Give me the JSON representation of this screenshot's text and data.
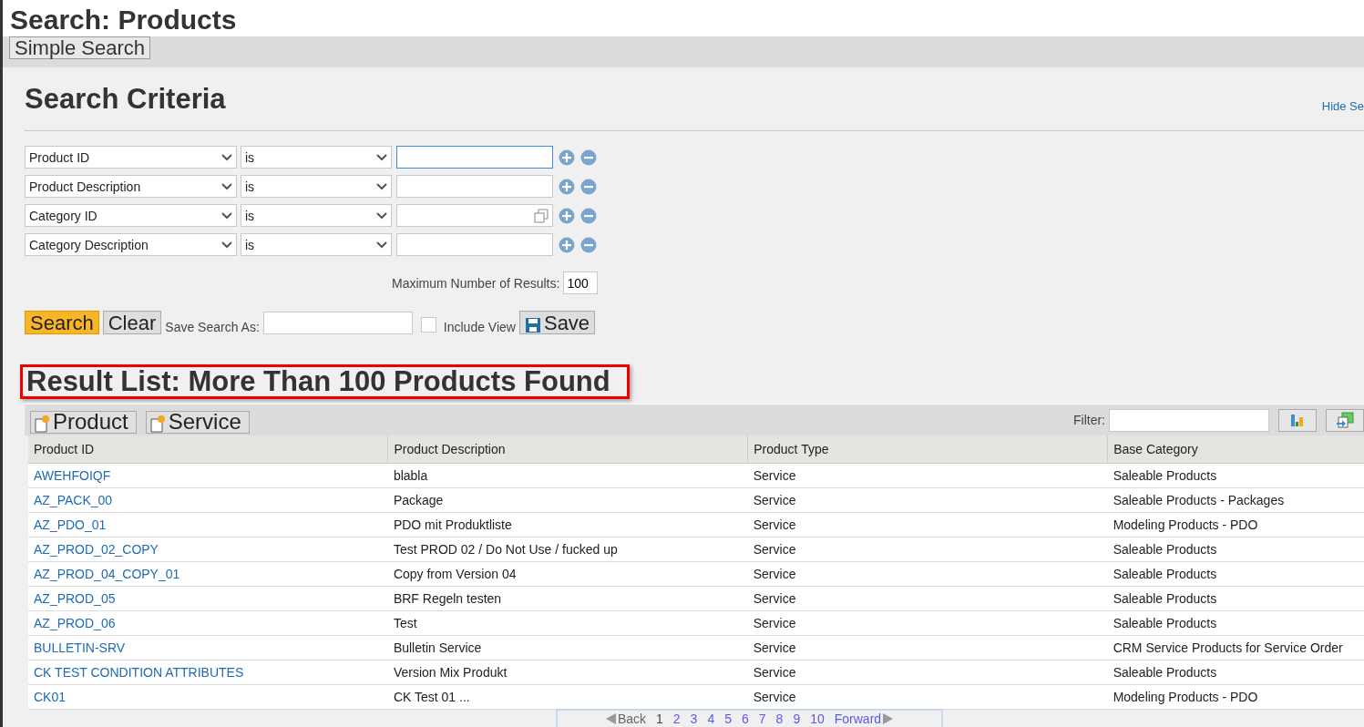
{
  "title": "Search: Products",
  "tabs": [
    {
      "label": "Simple Search",
      "selected": true
    }
  ],
  "criteria": {
    "heading": "Search Criteria",
    "hide_link": "Hide Se",
    "rows": [
      {
        "field": "Product ID",
        "operator": "is",
        "value": "",
        "focused": true,
        "value_help": false
      },
      {
        "field": "Product Description",
        "operator": "is",
        "value": "",
        "focused": false,
        "value_help": false
      },
      {
        "field": "Category ID",
        "operator": "is",
        "value": "",
        "focused": false,
        "value_help": true
      },
      {
        "field": "Category Description",
        "operator": "is",
        "value": "",
        "focused": false,
        "value_help": false
      }
    ],
    "max_results_label": "Maximum Number of Results:",
    "max_results": "100",
    "search_button": "Search",
    "clear_button": "Clear",
    "save_as_label": "Save Search As:",
    "include_view": {
      "label": "Include View",
      "checked": false
    },
    "save_button": "Save"
  },
  "results": {
    "heading": "Result List: More Than 100 Products Found",
    "new_buttons": [
      "Product",
      "Service"
    ],
    "filter_label": "Filter:",
    "columns": [
      "Product ID",
      "Product Description",
      "Product Type",
      "Base Category"
    ],
    "rows": [
      [
        "AWEHFOIQF",
        "blabla",
        "Service",
        "Saleable Products"
      ],
      [
        "AZ_PACK_00",
        "Package",
        "Service",
        "Saleable Products - Packages"
      ],
      [
        "AZ_PDO_01",
        "PDO mit Produktliste",
        "Service",
        "Modeling Products - PDO"
      ],
      [
        "AZ_PROD_02_COPY",
        "Test PROD 02 / Do Not Use / fucked up",
        "Service",
        "Saleable Products"
      ],
      [
        "AZ_PROD_04_COPY_01",
        "Copy from Version 04",
        "Service",
        "Saleable Products"
      ],
      [
        "AZ_PROD_05",
        "BRF Regeln testen",
        "Service",
        "Saleable Products"
      ],
      [
        "AZ_PROD_06",
        "Test",
        "Service",
        "Saleable Products"
      ],
      [
        "BULLETIN-SRV",
        "Bulletin Service",
        "Service",
        "CRM Service Products for Service Order"
      ],
      [
        "CK TEST CONDITION ATTRIBUTES",
        "Version Mix Produkt",
        "Service",
        "Saleable Products"
      ],
      [
        "CK01",
        "CK Test 01 ...",
        "Service",
        "Modeling Products - PDO"
      ]
    ],
    "pager": {
      "back": "Back",
      "forward": "Forward",
      "pages": [
        {
          "label": "1",
          "selected": true
        },
        {
          "label": "2",
          "selected": false
        },
        {
          "label": "3",
          "selected": false
        },
        {
          "label": "4",
          "selected": false
        },
        {
          "label": "5",
          "selected": false
        },
        {
          "label": "6",
          "selected": false
        },
        {
          "label": "7",
          "selected": false
        },
        {
          "label": "8",
          "selected": false
        },
        {
          "label": "9",
          "selected": false
        },
        {
          "label": "10",
          "selected": false
        }
      ]
    }
  }
}
